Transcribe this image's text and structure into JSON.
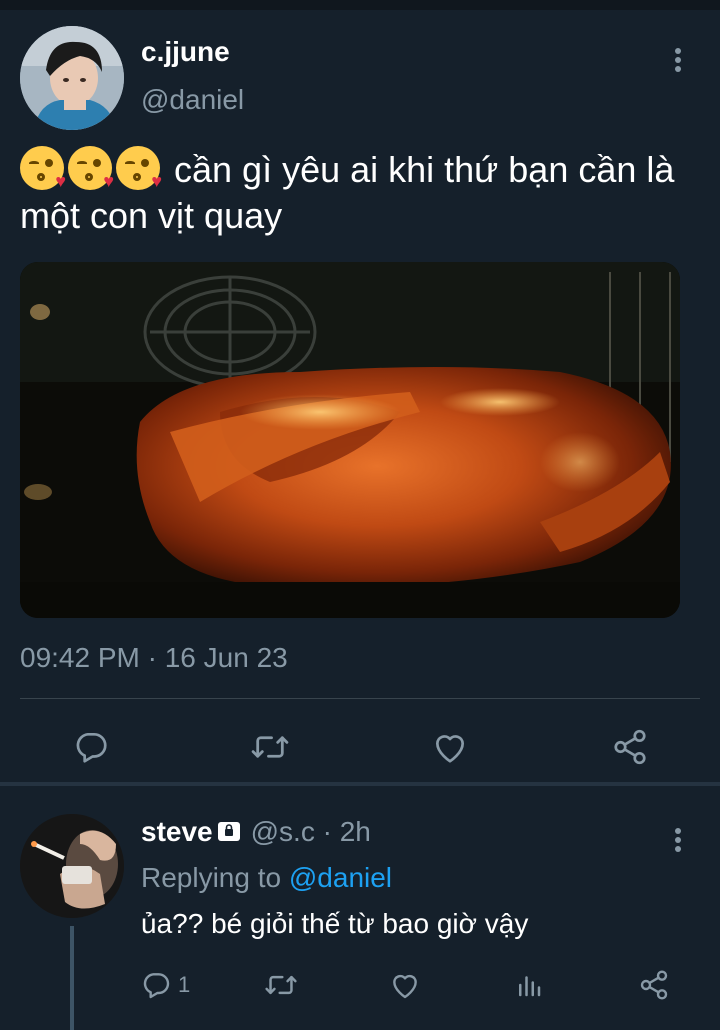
{
  "tweet": {
    "display_name": "c.jjune",
    "handle": "@daniel",
    "emojis": [
      "kissing-heart-emoji",
      "kissing-heart-emoji",
      "kissing-heart-emoji"
    ],
    "text": " cần gì yêu ai khi thứ bạn cần là một con vịt quay",
    "timestamp": "09:42 PM · 16 Jun 23",
    "actions": [
      "reply-icon",
      "retweet-icon",
      "like-icon",
      "share-icon"
    ]
  },
  "reply": {
    "display_name": "steve",
    "handle": "@s.c",
    "separator": "·",
    "time": "2h",
    "replying_prefix": "Replying to ",
    "replying_to": "@daniel",
    "text": "ủa?? bé giỏi thế từ bao giờ vậy",
    "reply_count": "1",
    "actions": [
      "reply-icon",
      "retweet-icon",
      "like-icon",
      "analytics-icon",
      "share-icon"
    ]
  },
  "colors": {
    "background": "#15202b",
    "primary_text": "#ffffff",
    "secondary_text": "#8899a6",
    "link": "#1da1f2",
    "divider": "#38444d"
  }
}
